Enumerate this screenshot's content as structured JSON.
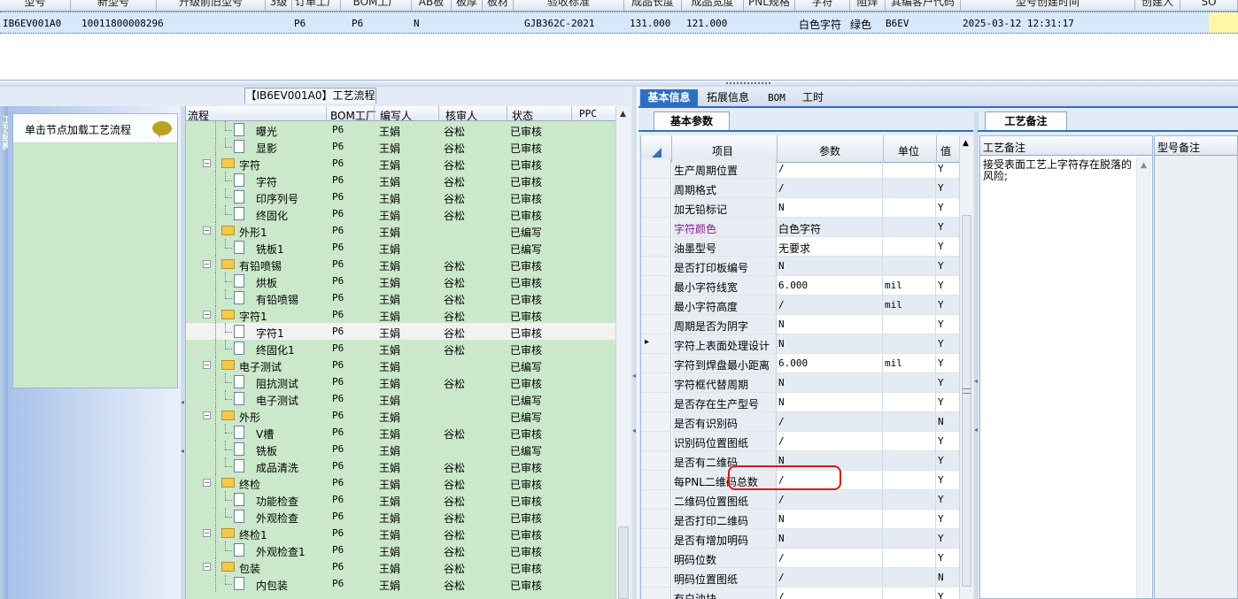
{
  "top_grid": {
    "headers": [
      "型号",
      "新型号",
      "升级前旧型号",
      "3级",
      "订单工厂",
      "BOM工厂",
      "AB板",
      "板厚",
      "板材",
      "验收标准",
      "成品长度",
      "成品宽度",
      "PNL规格",
      "字符",
      "阻焊",
      "其编客户代码",
      "型号创建时间",
      "创建人",
      "SO"
    ],
    "row": {
      "model": "IB6EV001A0",
      "new_model": "10011800008296",
      "order_factory": "P6",
      "bom_factory": "P6",
      "ab": "N",
      "standard": "GJB362C-2021",
      "length": "131.000",
      "width": "121.000",
      "char": "白色字符",
      "mask": "绿色",
      "cust_code": "B6EV",
      "created": "2025-03-12 12:31:17"
    }
  },
  "left": {
    "sidebar_label": "工艺结构",
    "process_tab": "【IB6EV001A0】工艺流程",
    "load_hint": "单击节点加载工艺流程",
    "tree_headers": [
      "流程",
      "BOM工厂",
      "编写人",
      "核审人",
      "状态",
      "PPC"
    ],
    "rows": [
      {
        "name": "曝光",
        "type": "doc",
        "factory": "P6",
        "writer": "王娟",
        "reviewer": "谷松",
        "status": "已审核"
      },
      {
        "name": "显影",
        "type": "doc",
        "factory": "P6",
        "writer": "王娟",
        "reviewer": "谷松",
        "status": "已审核"
      },
      {
        "name": "字符",
        "type": "folder",
        "factory": "P6",
        "writer": "王娟",
        "reviewer": "谷松",
        "status": "已审核"
      },
      {
        "name": "字符",
        "type": "doc",
        "factory": "P6",
        "writer": "王娟",
        "reviewer": "谷松",
        "status": "已审核"
      },
      {
        "name": "印序列号",
        "type": "doc",
        "factory": "P6",
        "writer": "王娟",
        "reviewer": "谷松",
        "status": "已审核"
      },
      {
        "name": "终固化",
        "type": "doc",
        "factory": "P6",
        "writer": "王娟",
        "reviewer": "谷松",
        "status": "已审核"
      },
      {
        "name": "外形1",
        "type": "folder",
        "factory": "P6",
        "writer": "王娟",
        "reviewer": "",
        "status": "已编写"
      },
      {
        "name": "铣板1",
        "type": "doc",
        "factory": "P6",
        "writer": "王娟",
        "reviewer": "",
        "status": "已编写"
      },
      {
        "name": "有铅喷锡",
        "type": "folder",
        "factory": "P6",
        "writer": "王娟",
        "reviewer": "谷松",
        "status": "已审核"
      },
      {
        "name": "烘板",
        "type": "doc",
        "factory": "P6",
        "writer": "王娟",
        "reviewer": "谷松",
        "status": "已审核"
      },
      {
        "name": "有铅喷锡",
        "type": "doc",
        "factory": "P6",
        "writer": "王娟",
        "reviewer": "谷松",
        "status": "已审核"
      },
      {
        "name": "字符1",
        "type": "folder",
        "factory": "P6",
        "writer": "王娟",
        "reviewer": "谷松",
        "status": "已审核"
      },
      {
        "name": "字符1",
        "type": "doc",
        "factory": "P6",
        "writer": "王娟",
        "reviewer": "谷松",
        "status": "已审核"
      },
      {
        "name": "终固化1",
        "type": "doc",
        "factory": "P6",
        "writer": "王娟",
        "reviewer": "谷松",
        "status": "已审核"
      },
      {
        "name": "电子测试",
        "type": "folder",
        "factory": "P6",
        "writer": "王娟",
        "reviewer": "",
        "status": "已编写"
      },
      {
        "name": "阻抗测试",
        "type": "doc",
        "factory": "P6",
        "writer": "王娟",
        "reviewer": "谷松",
        "status": "已审核"
      },
      {
        "name": "电子测试",
        "type": "doc",
        "factory": "P6",
        "writer": "王娟",
        "reviewer": "",
        "status": "已编写"
      },
      {
        "name": "外形",
        "type": "folder",
        "factory": "P6",
        "writer": "王娟",
        "reviewer": "",
        "status": "已编写"
      },
      {
        "name": "V槽",
        "type": "doc",
        "factory": "P6",
        "writer": "王娟",
        "reviewer": "谷松",
        "status": "已审核"
      },
      {
        "name": "铣板",
        "type": "doc",
        "factory": "P6",
        "writer": "王娟",
        "reviewer": "",
        "status": "已编写"
      },
      {
        "name": "成品清洗",
        "type": "doc",
        "factory": "P6",
        "writer": "王娟",
        "reviewer": "谷松",
        "status": "已审核"
      },
      {
        "name": "终检",
        "type": "folder",
        "factory": "P6",
        "writer": "王娟",
        "reviewer": "谷松",
        "status": "已审核"
      },
      {
        "name": "功能检查",
        "type": "doc",
        "factory": "P6",
        "writer": "王娟",
        "reviewer": "谷松",
        "status": "已审核"
      },
      {
        "name": "外观检查",
        "type": "doc",
        "factory": "P6",
        "writer": "王娟",
        "reviewer": "谷松",
        "status": "已审核"
      },
      {
        "name": "终检1",
        "type": "folder",
        "factory": "P6",
        "writer": "王娟",
        "reviewer": "谷松",
        "status": "已审核"
      },
      {
        "name": "外观检查1",
        "type": "doc",
        "factory": "P6",
        "writer": "王娟",
        "reviewer": "谷松",
        "status": "已审核"
      },
      {
        "name": "包装",
        "type": "folder",
        "factory": "P6",
        "writer": "王娟",
        "reviewer": "谷松",
        "status": "已审核"
      },
      {
        "name": "内包装",
        "type": "doc",
        "factory": "P6",
        "writer": "王娟",
        "reviewer": "谷松",
        "status": "已审核"
      }
    ]
  },
  "right": {
    "tabs": [
      "基本信息",
      "拓展信息",
      "BOM",
      "工时"
    ],
    "basic_params_tab": "基本参数",
    "param_headers": [
      "项目",
      "参数",
      "单位",
      "值"
    ],
    "params": [
      {
        "item": "生产周期位置",
        "value": "/",
        "unit": "",
        "flag": "Y"
      },
      {
        "item": "周期格式",
        "value": "/",
        "unit": "",
        "flag": "Y"
      },
      {
        "item": "加无铅标记",
        "value": "N",
        "unit": "",
        "flag": "Y"
      },
      {
        "item": "字符颜色",
        "value": "白色字符",
        "unit": "",
        "flag": "Y",
        "accent": true
      },
      {
        "item": "油墨型号",
        "value": "无要求",
        "unit": "",
        "flag": "Y"
      },
      {
        "item": "是否打印板编号",
        "value": "N",
        "unit": "",
        "flag": "Y"
      },
      {
        "item": "最小字符线宽",
        "value": "6.000",
        "unit": "mil",
        "flag": "Y"
      },
      {
        "item": "最小字符高度",
        "value": "/",
        "unit": "mil",
        "flag": "Y"
      },
      {
        "item": "周期是否为阴字",
        "value": "N",
        "unit": "",
        "flag": "Y"
      },
      {
        "item": "字符上表面处理设计",
        "value": "N",
        "unit": "",
        "flag": "Y",
        "current": true
      },
      {
        "item": "字符到焊盘最小距离",
        "value": "6.000",
        "unit": "mil",
        "flag": "Y"
      },
      {
        "item": "字符框代替周期",
        "value": "N",
        "unit": "",
        "flag": "Y"
      },
      {
        "item": "是否存在生产型号",
        "value": "N",
        "unit": "",
        "flag": "Y"
      },
      {
        "item": "是否有识别码",
        "value": "/",
        "unit": "",
        "flag": "N"
      },
      {
        "item": "识别码位置图纸",
        "value": "/",
        "unit": "",
        "flag": "Y"
      },
      {
        "item": "是否有二维码",
        "value": "N",
        "unit": "",
        "flag": "Y"
      },
      {
        "item": "每PNL二维码总数",
        "value": "/",
        "unit": "",
        "flag": "Y"
      },
      {
        "item": "二维码位置图纸",
        "value": "/",
        "unit": "",
        "flag": "Y"
      },
      {
        "item": "是否打印二维码",
        "value": "N",
        "unit": "",
        "flag": "Y"
      },
      {
        "item": "是否有增加明码",
        "value": "N",
        "unit": "",
        "flag": "Y"
      },
      {
        "item": "明码位数",
        "value": "/",
        "unit": "",
        "flag": "Y"
      },
      {
        "item": "明码位置图纸",
        "value": "/",
        "unit": "",
        "flag": "N"
      },
      {
        "item": "有白油块",
        "value": "/",
        "unit": "",
        "flag": "Y"
      }
    ],
    "remark_tab": "工艺备注",
    "remark_header": "工艺备注",
    "remark_text": "接受表面工艺上字符存在脱落的风险;",
    "model_remark_header": "型号备注"
  },
  "colors": {
    "accent_blue": "#2f6fc0",
    "tree_bg": "#cbe8cb",
    "highlight_red": "#d41a1a",
    "accent_text": "#8b1a8b"
  }
}
